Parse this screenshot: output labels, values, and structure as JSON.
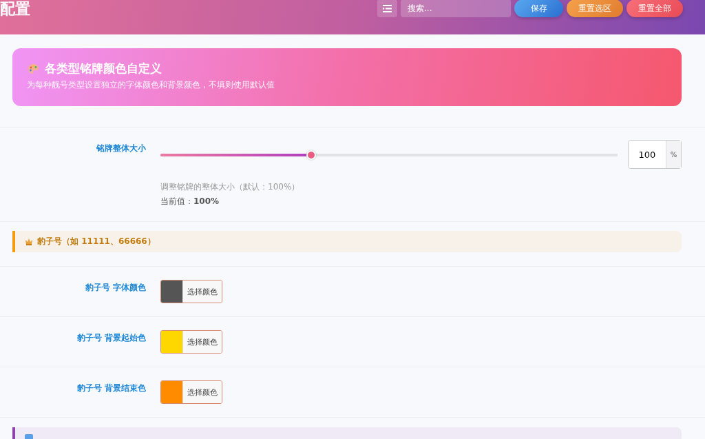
{
  "header": {
    "title": "配置",
    "search": {
      "placeholder": "搜索..."
    },
    "buttons": [
      {
        "label": "保存",
        "kind": "save"
      },
      {
        "label": "重置选区",
        "kind": "reset-section"
      },
      {
        "label": "重置全部",
        "kind": "reset-all"
      }
    ]
  },
  "banner": {
    "title": "各类型铭牌颜色自定义",
    "subtitle": "为每种靓号类型设置独立的字体颜色和背景颜色，不填则使用默认值"
  },
  "size_setting": {
    "label": "铭牌整体大小",
    "level": 0.33,
    "value": "100",
    "unit": "%",
    "hint": "调整铭牌的整体大小（默认：100%）",
    "current": "当前值：**100%**"
  },
  "sections": [
    {
      "title": "豹子号（如 11111、66666）",
      "color": "#f39c12",
      "kind": "crown",
      "fields": [
        {
          "label": "豹子号 字体颜色",
          "color": "#555555",
          "button": "选择颜色"
        },
        {
          "label": "豹子号 背景起始色",
          "color": "#ffd700",
          "button": "选择颜色"
        },
        {
          "label": "豹子号 背景结束色",
          "color": "#ff8c00",
          "button": "选择颜色"
        }
      ]
    },
    {
      "color": "#8e44ad",
      "kind": "square"
    }
  ]
}
